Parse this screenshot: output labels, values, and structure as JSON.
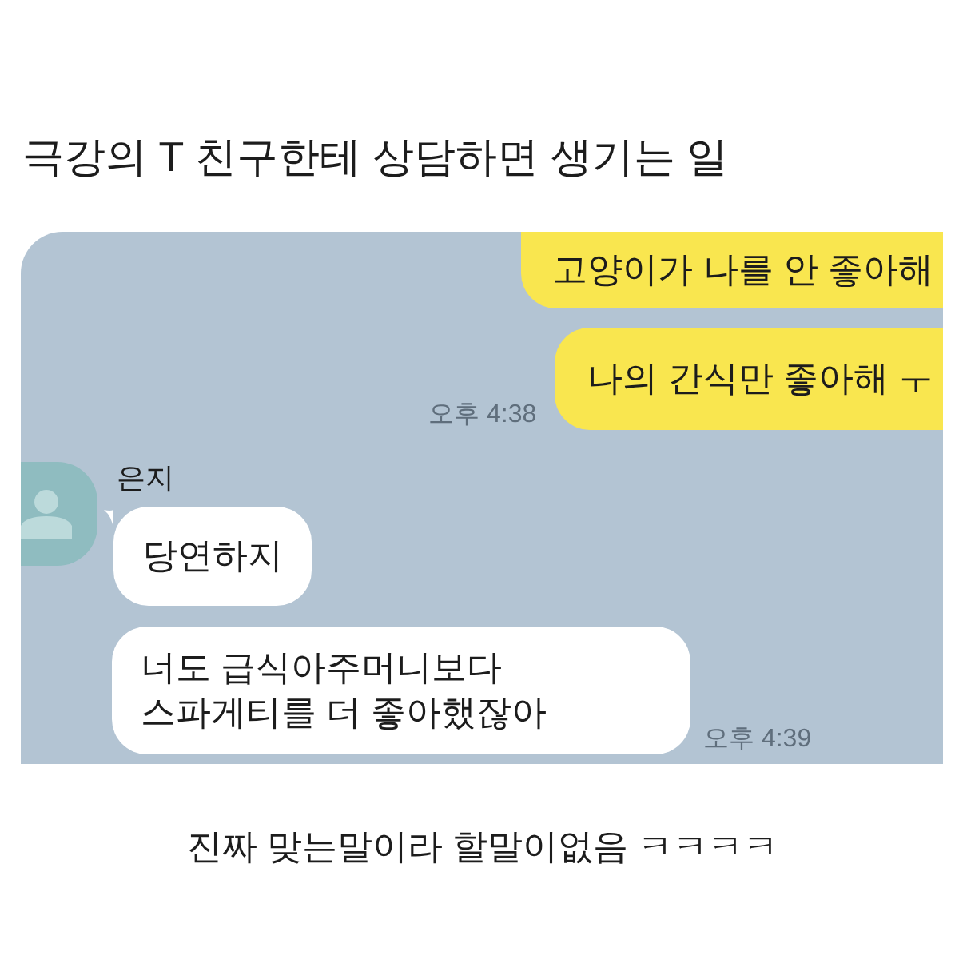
{
  "title": "극강의 T 친구한테 상담하면 생기는 일",
  "chat": {
    "messages": [
      {
        "kind": "sent",
        "text": "고양이가 나를 안 좋아해"
      },
      {
        "kind": "sent",
        "text": "나의 간식만 좋아해 ㅜ",
        "time": "오후 4:38"
      },
      {
        "kind": "received",
        "sender": "은지",
        "text": "당연하지"
      },
      {
        "kind": "received",
        "text": "너도 급식아주머니보다\n스파게티를 더 좋아했잖아",
        "time": "오후 4:39"
      }
    ]
  },
  "caption": "진짜 맞는말이라 할말이없음 ㅋㅋㅋㅋ"
}
